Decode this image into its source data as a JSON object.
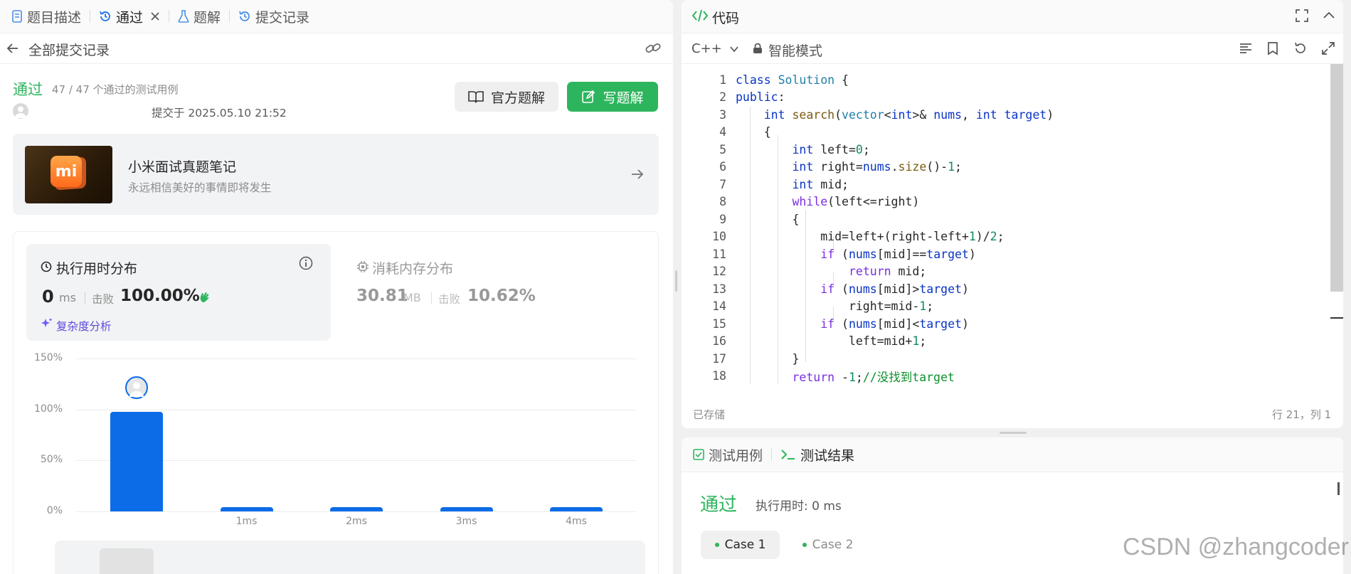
{
  "left_tabs": [
    {
      "label": "题目描述",
      "icon": "document-icon"
    },
    {
      "label": "通过",
      "icon": "history-icon"
    },
    {
      "label": "题解",
      "icon": "flask-icon"
    },
    {
      "label": "提交记录",
      "icon": "history-icon"
    }
  ],
  "submission_header": {
    "back_label": "全部提交记录"
  },
  "submission": {
    "status": "通过",
    "summary": "47 / 47 个通过的测试用例",
    "submitted_at": "提交于 2025.05.10 21:52",
    "official_solution_label": "官方题解",
    "write_solution_label": "写题解"
  },
  "ad": {
    "title": "小米面试真题笔记",
    "subtitle": "永远相信美好的事情即将发生",
    "logo_text": "mi"
  },
  "runtime": {
    "title": "执行用时分布",
    "value": "0",
    "unit": "ms",
    "beats_label": "击败",
    "beats_value": "100.00%",
    "complexity_label": "复杂度分析"
  },
  "memory": {
    "title": "消耗内存分布",
    "value": "30.81",
    "unit": "MB",
    "beats_label": "击败",
    "beats_value": "10.62%"
  },
  "chart_data": {
    "type": "bar",
    "categories": [
      "0ms",
      "1ms",
      "2ms",
      "3ms",
      "4ms"
    ],
    "tick_labels": [
      "",
      "1ms",
      "2ms",
      "3ms",
      "4ms"
    ],
    "values": [
      98,
      2,
      2,
      2,
      2
    ],
    "y_ticks": [
      "0%",
      "50%",
      "100%",
      "150%"
    ],
    "ylim": [
      0,
      150
    ],
    "grid": true,
    "color": "#0c6ce8"
  },
  "editor": {
    "title": "代码",
    "language": "C++",
    "mode": "智能模式",
    "saved_label": "已存储",
    "cursor_label": "行 21，列 1",
    "line_numbers": [
      "1",
      "2",
      "3",
      "4",
      "5",
      "6",
      "7",
      "8",
      "9",
      "10",
      "11",
      "12",
      "13",
      "14",
      "15",
      "16",
      "17",
      "18"
    ]
  },
  "result": {
    "tab_testcase": "测试用例",
    "tab_result": "测试结果",
    "status": "通过",
    "runtime": "执行用时: 0 ms",
    "cases": [
      "Case 1",
      "Case 2"
    ]
  },
  "watermark": "CSDN @zhangcoder",
  "colors": {
    "accent_green": "#2db55d",
    "bar_blue": "#0c6ce8",
    "link_purple": "#5b4bdb"
  }
}
